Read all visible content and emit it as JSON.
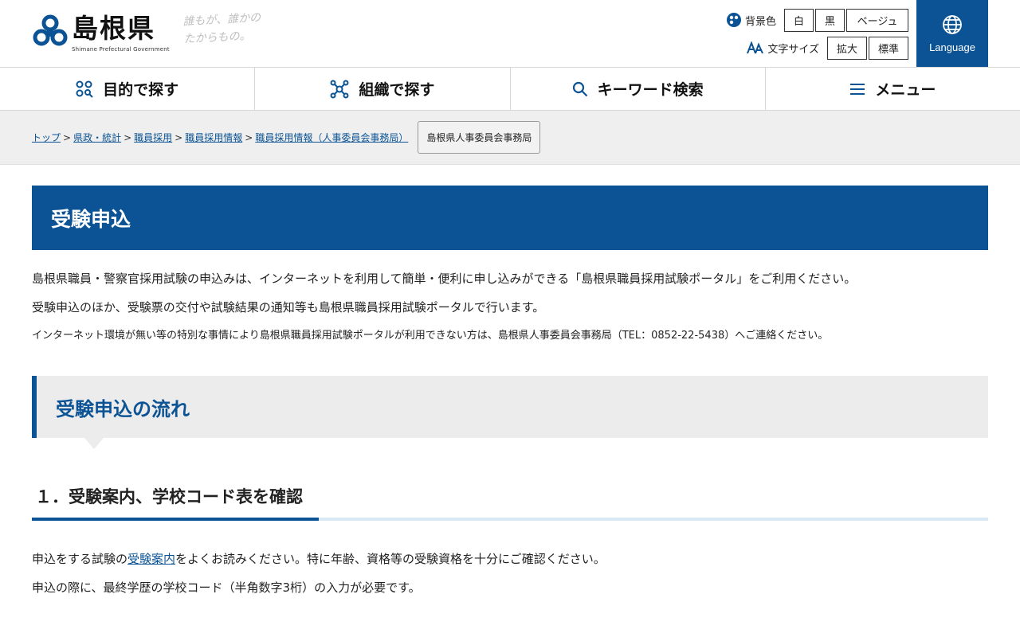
{
  "header": {
    "logo_title": "島根県",
    "logo_sub": "Shimane Prefectural Government",
    "tagline_1": "誰もが、誰かの",
    "tagline_2": "たからもの。",
    "bg_label": "背景色",
    "bg_buttons": [
      "白",
      "黒",
      "ベージュ"
    ],
    "text_label": "文字サイズ",
    "text_buttons": [
      "拡大",
      "標準"
    ],
    "language": "Language"
  },
  "nav": [
    "目的で探す",
    "組織で探す",
    "キーワード検索",
    "メニュー"
  ],
  "breadcrumb": {
    "items": [
      "トップ",
      "県政・統計",
      "職員採用",
      "職員採用情報",
      "職員採用情報（人事委員会事務局）"
    ],
    "tag": "島根県人事委員会事務局"
  },
  "main": {
    "title": "受験申込",
    "para1": "島根県職員・警察官採用試験の申込みは、インターネットを利用して簡単・便利に申し込みができる「島根県職員採用試験ポータル」をご利用ください。",
    "para2": "受験申込のほか、受験票の交付や試験結果の通知等も島根県職員採用試験ポータルで行います。",
    "para3": "インターネット環境が無い等の特別な事情により島根県職員採用試験ポータルが利用できない方は、島根県人事委員会事務局（TEL：0852-22-5438）へご連絡ください。",
    "section_title": "受験申込の流れ",
    "step1_title": "１．受験案内、学校コード表を確認",
    "step1_p1_before": "申込をする試験の",
    "step1_p1_link": "受験案内",
    "step1_p1_after": "をよくお読みください。特に年齢、資格等の受験資格を十分にご確認ください。",
    "step1_p2": "申込の際に、最終学歴の学校コード（半角数字3桁）の入力が必要です。"
  },
  "colors": {
    "brand": "#0b5394",
    "subheader_bg": "#ececec"
  }
}
